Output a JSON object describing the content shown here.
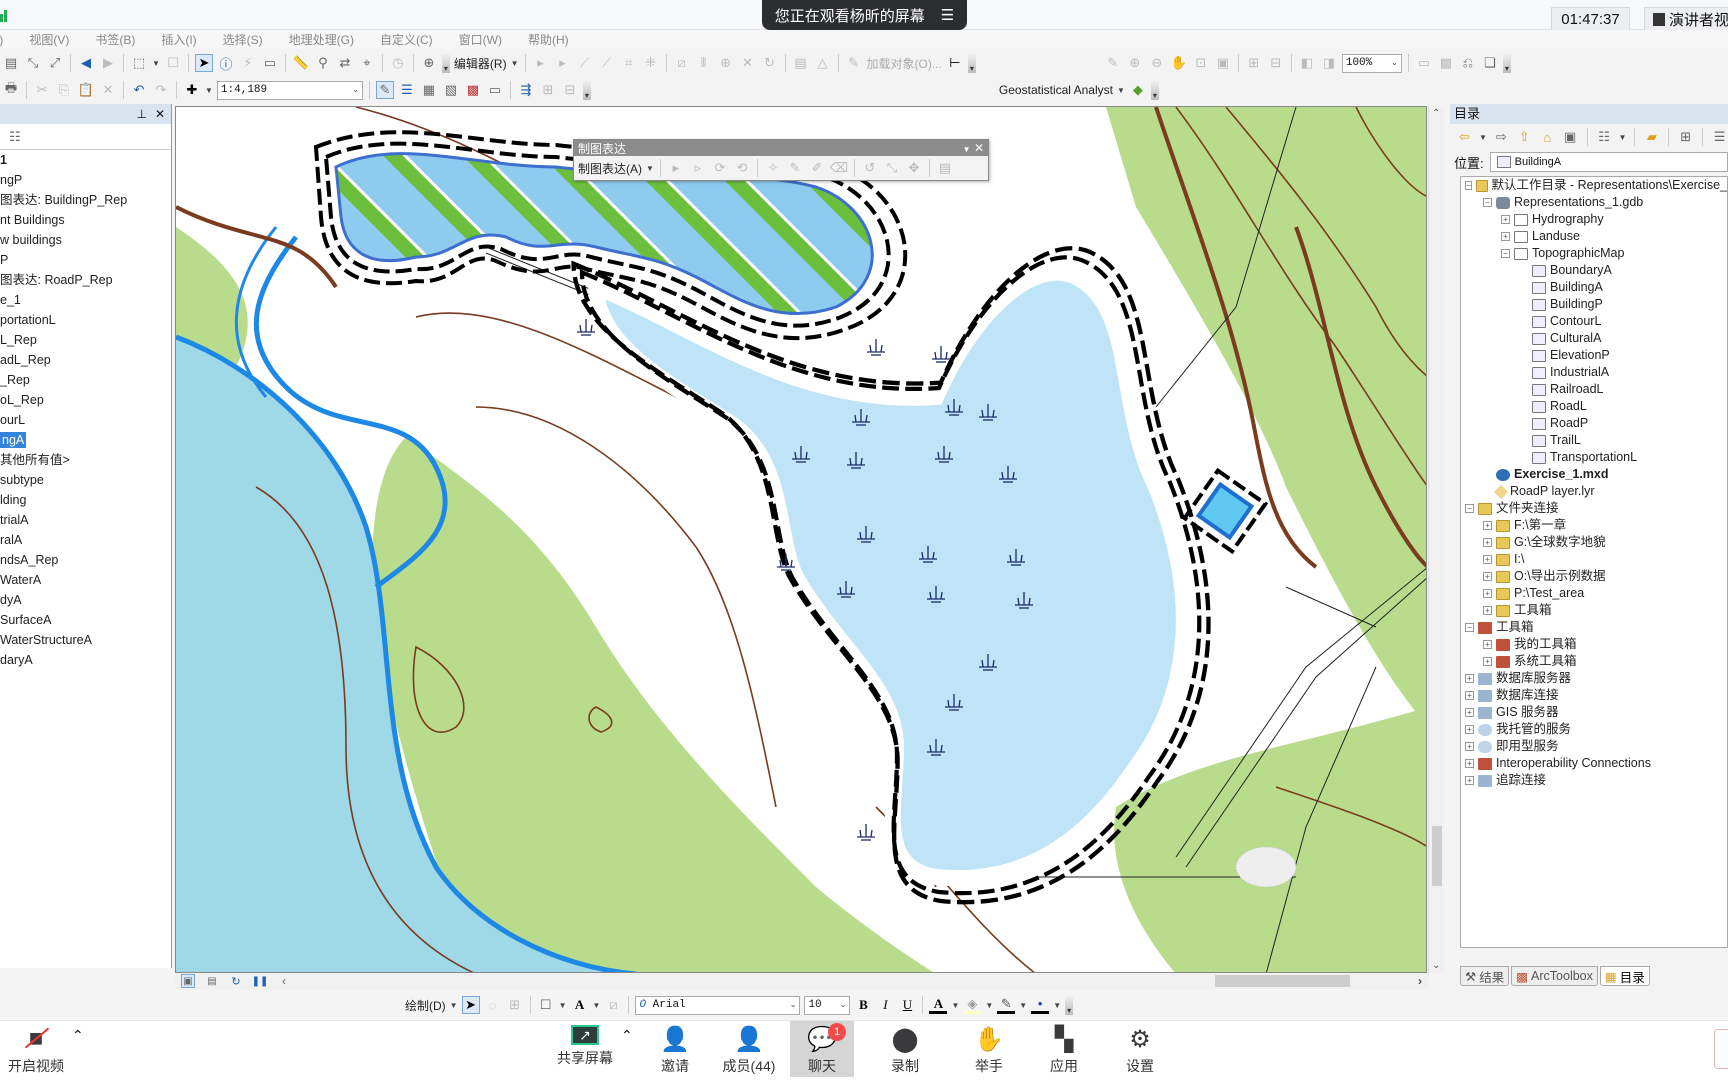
{
  "meeting": {
    "share_banner": "您正在观看杨昕的屏幕",
    "timer": "01:47:37",
    "presenter_view": "演讲者视",
    "bottom": {
      "video": "开启视频",
      "share_screen": "共享屏幕",
      "invite": "邀请",
      "members": "成员(44)",
      "chat": "聊天",
      "chat_badge": "1",
      "record": "录制",
      "raise_hand": "举手",
      "apps": "应用",
      "settings": "设置"
    }
  },
  "menu": [
    "文件(F)",
    "视图(V)",
    "书签(B)",
    "插入(I)",
    "选择(S)",
    "地理处理(G)",
    "自定义(C)",
    "窗口(W)",
    "帮助(H)"
  ],
  "toolbar": {
    "editor": "编辑器(R)",
    "load_objects": "加载对象(O)...",
    "scale": "1:4,189",
    "zoom_pct": "100%",
    "geostat": "Geostatistical Analyst"
  },
  "rep_toolbar": {
    "title": "制图表达",
    "menu": "制图表达(A)"
  },
  "toc": {
    "items": [
      {
        "label": "1",
        "bold": true
      },
      {
        "label": "ngP"
      },
      {
        "label": "图表达: BuildingP_Rep"
      },
      {
        "label": "nt Buildings"
      },
      {
        "label": "w buildings"
      },
      {
        "label": "P"
      },
      {
        "label": "图表达: RoadP_Rep"
      },
      {
        "label": "e_1"
      },
      {
        "label": "portationL"
      },
      {
        "label": "L_Rep"
      },
      {
        "label": "adL_Rep"
      },
      {
        "label": "_Rep"
      },
      {
        "label": "oL_Rep"
      },
      {
        "label": "ourL"
      },
      {
        "label": "ngA",
        "selected": true
      },
      {
        "label": "其他所有值>"
      },
      {
        "label": "subtype"
      },
      {
        "label": "lding"
      },
      {
        "label": "trialA"
      },
      {
        "label": "ralA"
      },
      {
        "label": "ndsA_Rep"
      },
      {
        "label": "WaterA"
      },
      {
        "label": "dyA"
      },
      {
        "label": "SurfaceA"
      },
      {
        "label": "WaterStructureA"
      },
      {
        "label": "daryA"
      }
    ]
  },
  "catalog": {
    "title": "目录",
    "location_label": "位置:",
    "location_value": "BuildingA",
    "tree": [
      {
        "level": 0,
        "exp": "-",
        "icon": "folder",
        "label": "默认工作目录 - Representations\\Exercise_"
      },
      {
        "level": 1,
        "exp": "-",
        "icon": "gdb",
        "label": "Representations_1.gdb"
      },
      {
        "level": 2,
        "exp": "+",
        "icon": "fds",
        "label": "Hydrography"
      },
      {
        "level": 2,
        "exp": "+",
        "icon": "fds",
        "label": "Landuse"
      },
      {
        "level": 2,
        "exp": "-",
        "icon": "fds",
        "label": "TopographicMap"
      },
      {
        "level": 3,
        "icon": "fc",
        "label": "BoundaryA"
      },
      {
        "level": 3,
        "icon": "fc",
        "label": "BuildingA"
      },
      {
        "level": 3,
        "icon": "fc",
        "label": "BuildingP"
      },
      {
        "level": 3,
        "icon": "fc",
        "label": "ContourL"
      },
      {
        "level": 3,
        "icon": "fc",
        "label": "CulturalA"
      },
      {
        "level": 3,
        "icon": "fc",
        "label": "ElevationP"
      },
      {
        "level": 3,
        "icon": "fc",
        "label": "IndustrialA"
      },
      {
        "level": 3,
        "icon": "fc",
        "label": "RailroadL"
      },
      {
        "level": 3,
        "icon": "fc",
        "label": "RoadL"
      },
      {
        "level": 3,
        "icon": "fc",
        "label": "RoadP"
      },
      {
        "level": 3,
        "icon": "fc",
        "label": "TrailL"
      },
      {
        "level": 3,
        "icon": "fc",
        "label": "TransportationL"
      },
      {
        "level": 1,
        "icon": "mxd",
        "label": "Exercise_1.mxd",
        "bold": true
      },
      {
        "level": 1,
        "icon": "lyr",
        "label": "RoadP layer.lyr"
      },
      {
        "level": 0,
        "exp": "-",
        "icon": "folder",
        "label": "文件夹连接"
      },
      {
        "level": 1,
        "exp": "+",
        "icon": "folder",
        "label": "F:\\第一章"
      },
      {
        "level": 1,
        "exp": "+",
        "icon": "folder",
        "label": "G:\\全球数字地貌"
      },
      {
        "level": 1,
        "exp": "+",
        "icon": "folder",
        "label": "I:\\"
      },
      {
        "level": 1,
        "exp": "+",
        "icon": "folder",
        "label": "O:\\导出示例数据"
      },
      {
        "level": 1,
        "exp": "+",
        "icon": "folder",
        "label": "P:\\Test_area"
      },
      {
        "level": 1,
        "exp": "+",
        "icon": "folder",
        "label": "工具箱"
      },
      {
        "level": 0,
        "exp": "-",
        "icon": "tool",
        "label": "工具箱"
      },
      {
        "level": 1,
        "exp": "+",
        "icon": "tool",
        "label": "我的工具箱"
      },
      {
        "level": 1,
        "exp": "+",
        "icon": "tool",
        "label": "系统工具箱"
      },
      {
        "level": 0,
        "exp": "+",
        "icon": "srv",
        "label": "数据库服务器"
      },
      {
        "level": 0,
        "exp": "+",
        "icon": "srv",
        "label": "数据库连接"
      },
      {
        "level": 0,
        "exp": "+",
        "icon": "srv",
        "label": "GIS 服务器"
      },
      {
        "level": 0,
        "exp": "+",
        "icon": "cloud",
        "label": "我托管的服务"
      },
      {
        "level": 0,
        "exp": "+",
        "icon": "cloud",
        "label": "即用型服务"
      },
      {
        "level": 0,
        "exp": "+",
        "icon": "tool",
        "label": "Interoperability Connections"
      },
      {
        "level": 0,
        "exp": "+",
        "icon": "srv",
        "label": "追踪连接"
      }
    ],
    "tabs": [
      "结果",
      "ArcToolbox",
      "目录"
    ],
    "active_tab": 2
  },
  "drawbar": {
    "draw": "绘制(D)",
    "font": "Arial",
    "size": "10",
    "bold": "B",
    "italic": "I",
    "underline": "U"
  },
  "map_colors": {
    "water": "#bfe3f7",
    "river": "#1e88e5",
    "river_fill": "#9fd8e6",
    "vegetation": "#b9dc8c",
    "contour": "#7a3b1f",
    "stripe_green": "#6cbf3c",
    "stripe_blue": "#8fcbef",
    "marsh_symbol": "#1a2b6b"
  }
}
